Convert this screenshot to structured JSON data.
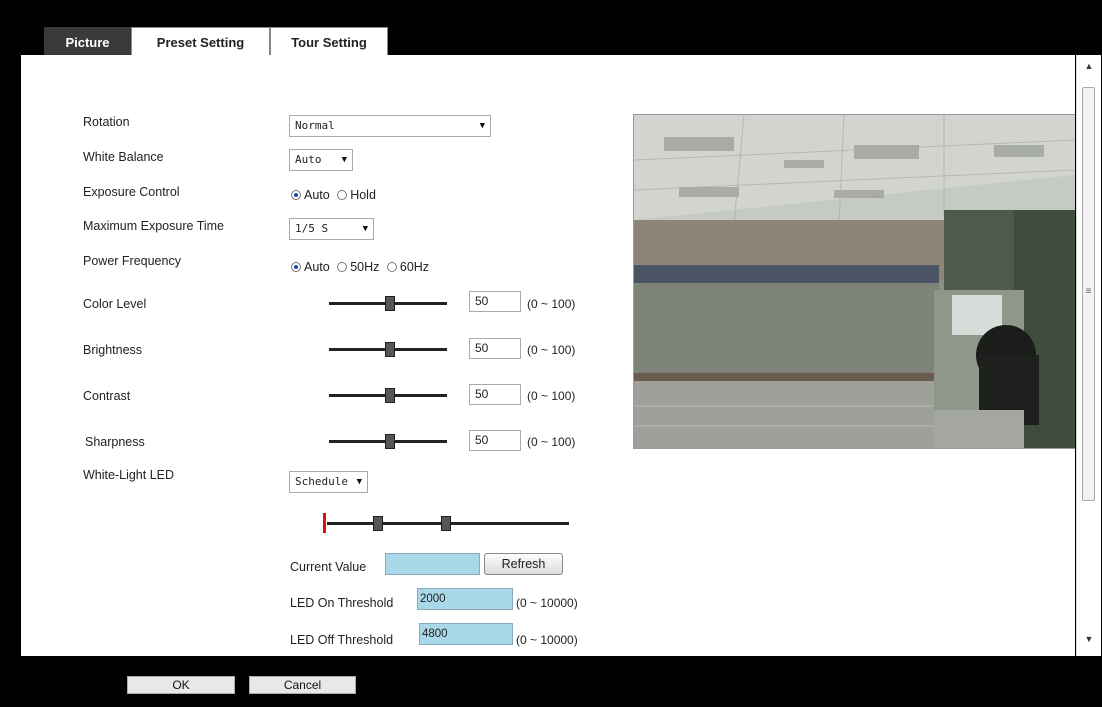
{
  "tabs": [
    {
      "label": "Picture"
    },
    {
      "label": "Preset Setting"
    },
    {
      "label": "Tour Setting"
    }
  ],
  "settings": {
    "rotation": {
      "label": "Rotation",
      "value": "Normal"
    },
    "white_balance": {
      "label": "White Balance",
      "value": "Auto"
    },
    "exposure_control": {
      "label": "Exposure Control",
      "opt_auto": "Auto",
      "opt_hold": "Hold",
      "selected": "Auto"
    },
    "max_exposure": {
      "label": "Maximum Exposure Time",
      "value": "1/5 S"
    },
    "power_frequency": {
      "label": "Power Frequency",
      "opt_auto": "Auto",
      "opt_50": "50Hz",
      "opt_60": "60Hz",
      "selected": "Auto"
    }
  },
  "sliders": {
    "color_level": {
      "label": "Color Level",
      "value": "50",
      "range": "(0 ~ 100)"
    },
    "brightness": {
      "label": "Brightness",
      "value": "50",
      "range": "(0 ~ 100)"
    },
    "contrast": {
      "label": "Contrast",
      "value": "50",
      "range": "(0 ~ 100)"
    },
    "sharpness": {
      "label": "Sharpness",
      "value": "50",
      "range": "(0 ~ 100)"
    }
  },
  "led": {
    "label": "White-Light LED",
    "mode": "Schedule",
    "current_value_label": "Current Value",
    "current_value": "",
    "refresh_label": "Refresh",
    "on_threshold_label": "LED On Threshold",
    "on_threshold_value": "2000",
    "on_threshold_range": "(0 ~ 10000)",
    "off_threshold_label": "LED Off Threshold",
    "off_threshold_value": "4800",
    "off_threshold_range": "(0 ~ 10000)"
  },
  "footer": {
    "ok_label": "OK",
    "cancel_label": "Cancel"
  }
}
